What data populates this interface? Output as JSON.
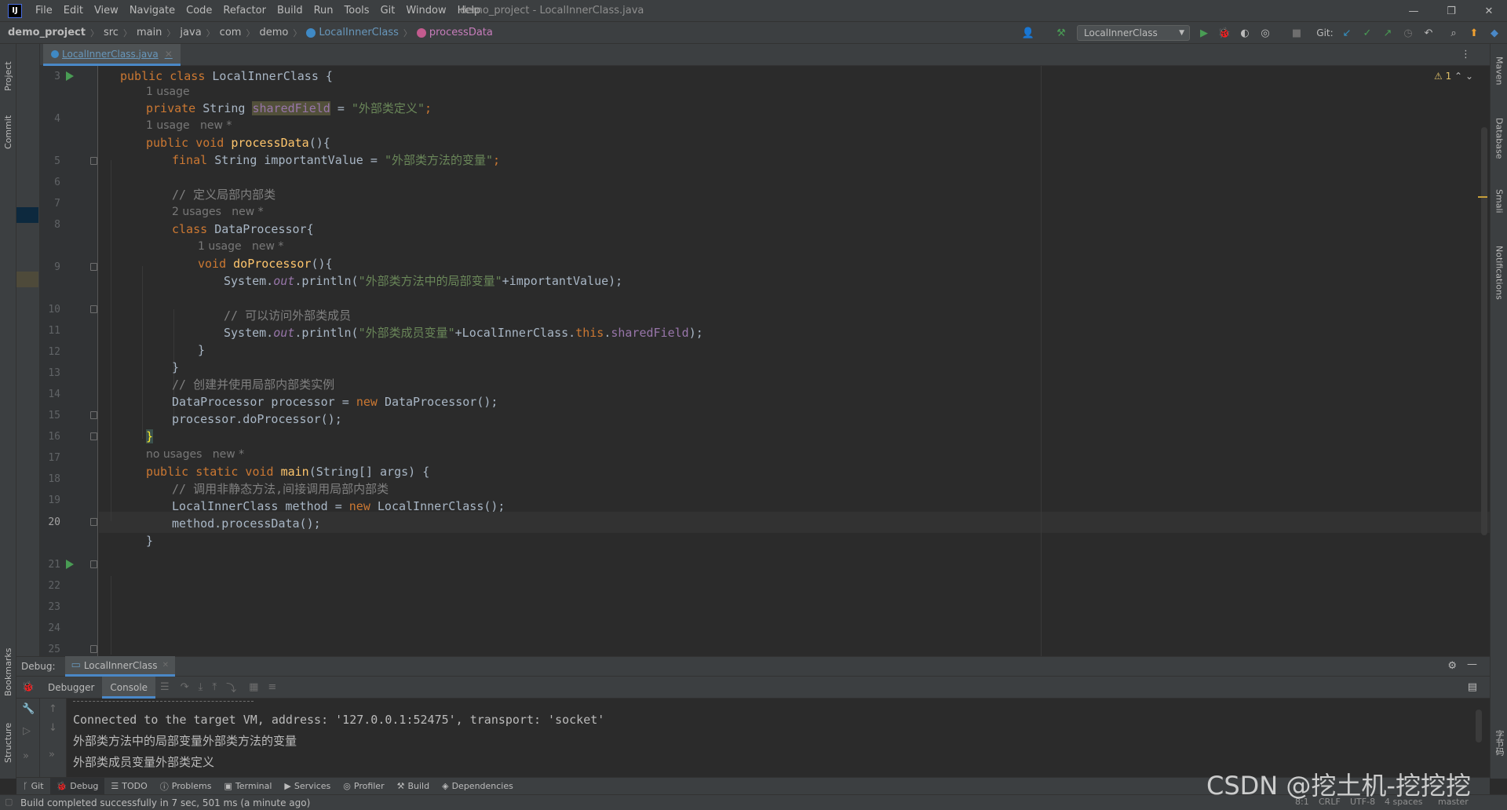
{
  "window": {
    "title": "demo_project - LocalInnerClass.java",
    "logo": "IJ",
    "controls": {
      "minimize": "—",
      "restore": "❐",
      "close": "✕"
    }
  },
  "menu": [
    "File",
    "Edit",
    "View",
    "Navigate",
    "Code",
    "Refactor",
    "Build",
    "Run",
    "Tools",
    "Git",
    "Window",
    "Help"
  ],
  "breadcrumb": {
    "project": "demo_project",
    "parts": [
      "src",
      "main",
      "java",
      "com",
      "demo"
    ],
    "class_name": "LocalInnerClass",
    "method_name": "processData"
  },
  "toolbar": {
    "run_config": "LocalInnerClass",
    "git_label": "Git:"
  },
  "left_tabs": {
    "project": "Project",
    "commit": "Commit",
    "bookmarks": "Bookmarks",
    "structure": "Structure"
  },
  "right_tabs": {
    "maven": "Maven",
    "database": "Database",
    "smali": "Smali",
    "notifications": "Notifications",
    "other": "字节码"
  },
  "editor": {
    "file_tab": "LocalInnerClass.java",
    "warning_count": "1",
    "line_numbers": [
      "3",
      "4",
      "5",
      "6",
      "7",
      "8",
      "9",
      "10",
      "11",
      "12",
      "13",
      "14",
      "15",
      "16",
      "17",
      "18",
      "19",
      "20",
      "21",
      "22",
      "23",
      "24",
      "25"
    ],
    "current_line": "20",
    "hints": {
      "h1": "1 usage",
      "h2": "1 usage   new *",
      "h3": "2 usages   new *",
      "h4": "1 usage   new *",
      "h5": "no usages   new *"
    },
    "code": {
      "l3_kw": "public class ",
      "l3_name": "LocalInnerClass {",
      "l4_kw": "private ",
      "l4_type": "String ",
      "l4_field": "sharedField",
      "l4_eq": " = ",
      "l4_str": "\"外部类定义\"",
      "l4_end": ";",
      "l5_kw": "public void ",
      "l5_fn": "processData",
      "l5_rest": "(){",
      "l6_kw": "final ",
      "l6_rest": "String importantValue = ",
      "l6_str": "\"外部类方法的变量\"",
      "l6_end": ";",
      "l8_cm": "// 定义局部内部类",
      "l9_kw": "class ",
      "l9_rest": "DataProcessor{",
      "l10_kw": "void ",
      "l10_fn": "doProcessor",
      "l10_rest": "(){",
      "l11_a": "System.",
      "l11_out": "out",
      "l11_b": ".println(",
      "l11_str": "\"外部类方法中的局部变量\"",
      "l11_c": "+importantValue);",
      "l13_cm": "// 可以访问外部类成员",
      "l14_a": "System.",
      "l14_out": "out",
      "l14_b": ".println(",
      "l14_str": "\"外部类成员变量\"",
      "l14_c": "+LocalInnerClass.",
      "l14_this": "this",
      "l14_d": ".",
      "l14_fld": "sharedField",
      "l14_e": ");",
      "l15": "}",
      "l16": "}",
      "l17_cm": "// 创建并使用局部内部类实例",
      "l18_a": "DataProcessor processor = ",
      "l18_kw": "new ",
      "l18_b": "DataProcessor();",
      "l19": "processor.doProcessor();",
      "l20": "}",
      "l21_kw": "public static void ",
      "l21_fn": "main",
      "l21_rest": "(String[] args) {",
      "l22_cm": "// 调用非静态方法,间接调用局部内部类",
      "l23_a": "LocalInnerClass method = ",
      "l23_kw": "new ",
      "l23_b": "LocalInnerClass();",
      "l24": "method.processData();",
      "l25": "}"
    }
  },
  "debug": {
    "label": "Debug:",
    "session_tab": "LocalInnerClass",
    "tabs": [
      "Debugger",
      "Console"
    ],
    "console_lines": [
      "Connected to the target VM, address: '127.0.0.1:52475', transport: 'socket'",
      "外部类方法中的局部变量外部类方法的变量",
      "外部类成员变量外部类定义"
    ]
  },
  "bottom_tools": [
    "Git",
    "Debug",
    "TODO",
    "Problems",
    "Terminal",
    "Services",
    "Profiler",
    "Build",
    "Dependencies"
  ],
  "status": {
    "message": "Build completed successfully in 7 sec, 501 ms (a minute ago)",
    "position": "8:1",
    "line_sep": "CRLF",
    "encoding": "UTF-8",
    "indent": "4 spaces",
    "branch": "master"
  },
  "watermark": "CSDN @挖土机-挖挖挖",
  "colors": {
    "keyword": "#cc7832",
    "string": "#6a8759",
    "comment": "#808080",
    "function": "#ffc66d",
    "field": "#9876aa",
    "text": "#a9b7c6",
    "accent": "#4a88c7"
  }
}
